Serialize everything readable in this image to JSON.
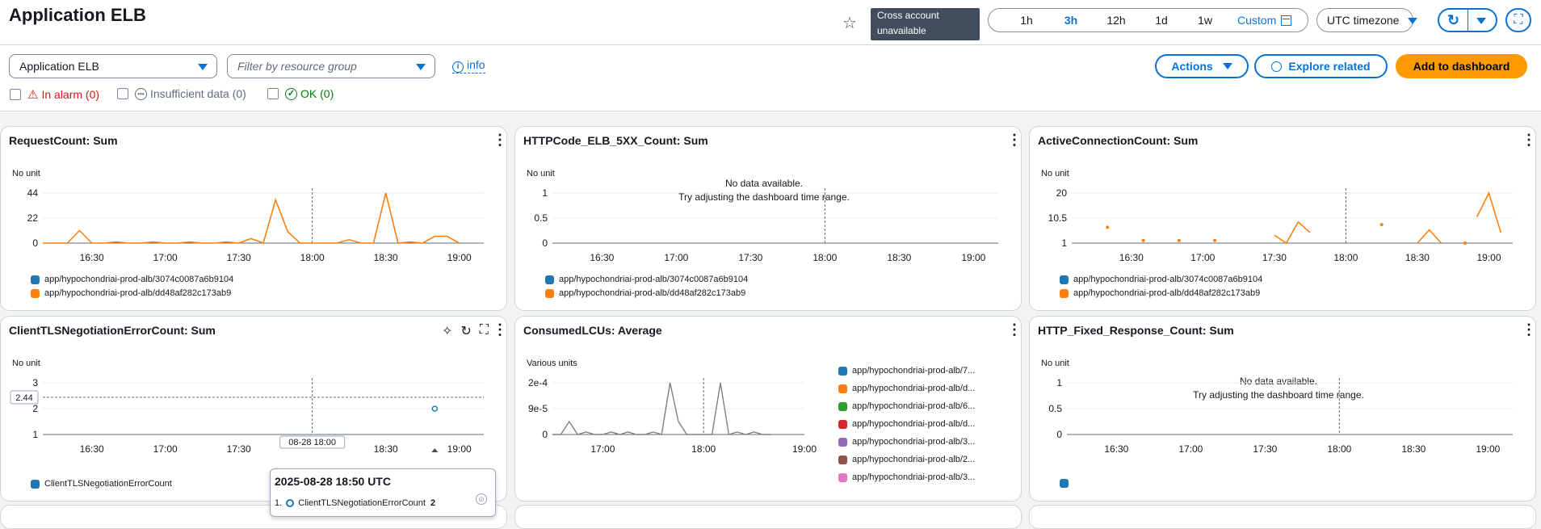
{
  "header": {
    "title": "Application ELB",
    "cross_account": [
      "Cross account",
      "unavailable"
    ],
    "time_ranges": [
      "1h",
      "3h",
      "12h",
      "1d",
      "1w"
    ],
    "custom_label": "Custom",
    "timezone": "UTC timezone"
  },
  "toolbar": {
    "service_select": "Application ELB",
    "resource_group_placeholder": "Filter by resource group",
    "info_label": "info",
    "actions_label": "Actions",
    "explore_label": "Explore related",
    "add_dashboard_label": "Add to dashboard"
  },
  "filters": {
    "in_alarm": "In alarm (0)",
    "insufficient": "Insufficient data (0)",
    "ok": "OK (0)"
  },
  "colors": {
    "blue": "#1f77b4",
    "orange": "#ff7f0e",
    "green": "#2ca02c",
    "red": "#d62728",
    "purple": "#9467bd",
    "brown": "#8c564b",
    "pink": "#e377c2",
    "accent": "#0972d3",
    "primary": "#ff9900"
  },
  "panels": {
    "p1": {
      "title": "RequestCount: Sum",
      "unit": "No unit",
      "yticks": [
        "44",
        "22",
        "0"
      ],
      "xticks": [
        "16:30",
        "17:00",
        "17:30",
        "18:00",
        "18:30",
        "19:00"
      ],
      "legend": [
        "app/hypochondriai-prod-alb/3074c0087a6b9104",
        "app/hypochondriai-prod-alb/dd48af282c173ab9"
      ]
    },
    "p2": {
      "title": "HTTPCode_ELB_5XX_Count: Sum",
      "unit": "No unit",
      "yticks": [
        "1",
        "0.5",
        "0"
      ],
      "xticks": [
        "16:30",
        "17:00",
        "17:30",
        "18:00",
        "18:30",
        "19:00"
      ],
      "nodata": "No data available.",
      "nodata_hint": "Try adjusting the dashboard time range.",
      "legend": [
        "app/hypochondriai-prod-alb/3074c0087a6b9104",
        "app/hypochondriai-prod-alb/dd48af282c173ab9"
      ]
    },
    "p3": {
      "title": "ActiveConnectionCount: Sum",
      "unit": "No unit",
      "yticks": [
        "20",
        "10.5",
        "1"
      ],
      "xticks": [
        "16:30",
        "17:00",
        "17:30",
        "18:00",
        "18:30",
        "19:00"
      ],
      "legend": [
        "app/hypochondriai-prod-alb/3074c0087a6b9104",
        "app/hypochondriai-prod-alb/dd48af282c173ab9"
      ]
    },
    "p4": {
      "title": "ClientTLSNegotiationErrorCount: Sum",
      "unit": "No unit",
      "yticks": [
        "3",
        "2",
        "1"
      ],
      "xticks": [
        "16:30",
        "17:00",
        "17:30",
        "18:30",
        "19:00"
      ],
      "hover_y": "2.44",
      "hover_x": "08-28 18:00",
      "legend": [
        "ClientTLSNegotiationErrorCount"
      ],
      "tooltip_time": "2025-08-28 18:50 UTC",
      "tooltip_idx": "1.",
      "tooltip_series": "ClientTLSNegotiationErrorCount",
      "tooltip_value": "2"
    },
    "p5": {
      "title": "ConsumedLCUs: Average",
      "unit": "Various units",
      "yticks": [
        "2e-4",
        "9e-5",
        "0"
      ],
      "xticks": [
        "17:00",
        "18:00",
        "19:00"
      ],
      "legend": [
        "app/hypochondriai-prod-alb/7...",
        "app/hypochondriai-prod-alb/d...",
        "app/hypochondriai-prod-alb/6...",
        "app/hypochondriai-prod-alb/d...",
        "app/hypochondriai-prod-alb/3...",
        "app/hypochondriai-prod-alb/2...",
        "app/hypochondriai-prod-alb/3..."
      ]
    },
    "p6": {
      "title": "HTTP_Fixed_Response_Count: Sum",
      "unit": "No unit",
      "yticks": [
        "1",
        "0.5",
        "0"
      ],
      "xticks": [
        "16:30",
        "17:00",
        "17:30",
        "18:00",
        "18:30",
        "19:00"
      ],
      "nodata": "No data available.",
      "nodata_hint": "Try adjusting the dashboard time range."
    }
  },
  "chart_data": [
    {
      "type": "line",
      "title": "RequestCount: Sum",
      "ylabel": "No unit",
      "ylim": [
        0,
        44
      ],
      "x": [
        "16:10",
        "16:15",
        "16:20",
        "16:25",
        "16:30",
        "16:35",
        "16:40",
        "16:45",
        "16:50",
        "16:55",
        "17:00",
        "17:05",
        "17:10",
        "17:15",
        "17:20",
        "17:25",
        "17:30",
        "17:35",
        "17:40",
        "17:45",
        "17:50",
        "17:55",
        "18:00",
        "18:05",
        "18:10",
        "18:15",
        "18:20",
        "18:25",
        "18:30",
        "18:35",
        "18:40",
        "18:45",
        "18:50",
        "18:55",
        "19:00"
      ],
      "series": [
        {
          "name": "app/hypochondriai-prod-alb/dd48af282c173ab9",
          "values": [
            0,
            0,
            0,
            11,
            0,
            0,
            1,
            0,
            0,
            1,
            0,
            0,
            1,
            0,
            0,
            1,
            0,
            4,
            0,
            38,
            10,
            0,
            0,
            0,
            0,
            3,
            0,
            0,
            44,
            0,
            1,
            0,
            6,
            6,
            0
          ]
        }
      ]
    },
    {
      "type": "line",
      "title": "HTTPCode_ELB_5XX_Count: Sum",
      "ylabel": "No unit",
      "ylim": [
        0,
        1
      ],
      "series": []
    },
    {
      "type": "line",
      "title": "ActiveConnectionCount: Sum",
      "ylabel": "No unit",
      "ylim": [
        1,
        20
      ],
      "x": [
        "16:20",
        "16:35",
        "16:50",
        "17:05",
        "17:30",
        "17:35",
        "17:40",
        "17:45",
        "18:15",
        "18:30",
        "18:35",
        "18:40",
        "18:50",
        "18:55",
        "19:00",
        "19:05"
      ],
      "series": [
        {
          "name": "app/hypochondriai-prod-alb/dd48af282c173ab9",
          "values": [
            7,
            2,
            2,
            2,
            4,
            1,
            9,
            5,
            8,
            1,
            6,
            1,
            1,
            11,
            20,
            5
          ]
        }
      ]
    },
    {
      "type": "scatter",
      "title": "ClientTLSNegotiationErrorCount: Sum",
      "ylabel": "No unit",
      "ylim": [
        1,
        3
      ],
      "x": [
        "18:50"
      ],
      "series": [
        {
          "name": "ClientTLSNegotiationErrorCount",
          "values": [
            2
          ]
        }
      ]
    },
    {
      "type": "line",
      "title": "ConsumedLCUs: Average",
      "ylabel": "Various units",
      "ylim": [
        0,
        0.0002
      ],
      "x": [
        "16:30",
        "16:35",
        "16:40",
        "16:45",
        "16:50",
        "16:55",
        "17:00",
        "17:05",
        "17:10",
        "17:15",
        "17:20",
        "17:25",
        "17:30",
        "17:35",
        "17:40",
        "17:45",
        "17:50",
        "17:55",
        "18:00",
        "18:05",
        "18:10",
        "18:15",
        "18:20",
        "18:25",
        "18:30",
        "18:35",
        "18:40"
      ],
      "series": [
        {
          "name": "app/hypochondriai-prod-alb/7...",
          "values": [
            0,
            0,
            5e-05,
            0,
            1e-05,
            0,
            0,
            1e-05,
            0,
            1e-05,
            0,
            0,
            1e-05,
            0,
            0.0002,
            5e-05,
            0,
            0,
            0,
            0,
            0.0002,
            0,
            1e-05,
            0,
            1e-05,
            0,
            0
          ]
        }
      ]
    },
    {
      "type": "line",
      "title": "HTTP_Fixed_Response_Count: Sum",
      "ylabel": "No unit",
      "ylim": [
        0,
        1
      ],
      "series": []
    }
  ]
}
